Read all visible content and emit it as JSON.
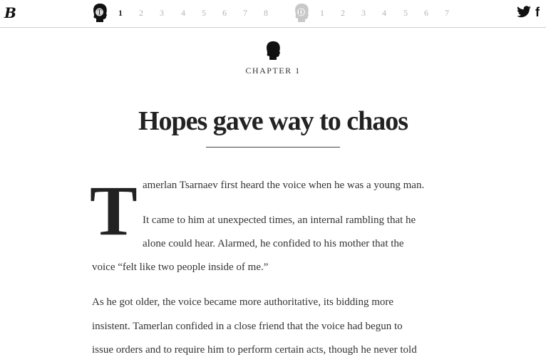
{
  "nav": {
    "logo": "B",
    "group_t": {
      "avatar_letter": "T",
      "numbers": [
        "1",
        "2",
        "3",
        "4",
        "5",
        "6",
        "7",
        "8"
      ],
      "active": "1"
    },
    "group_d": {
      "avatar_letter": "D",
      "numbers": [
        "1",
        "2",
        "3",
        "4",
        "5",
        "6",
        "7"
      ]
    },
    "social": {
      "twitter": "twitter-icon",
      "facebook": "f"
    }
  },
  "chapter": {
    "label": "CHAPTER 1",
    "title": "Hopes gave way to chaos"
  },
  "article": {
    "dropcap": "T",
    "lines_first": [
      "amerlan Tsarnaev first heard the voice when he was a young man.",
      "It came to him at unexpected times, an internal rambling that he",
      "alone could hear. Alarmed, he confided to his mother that the",
      "voice “felt like two people inside of me.”"
    ],
    "lines_second": [
      "As he got older, the voice became more authoritative, its bidding more",
      "insistent. Tamerlan confided in a close friend that the voice had begun to",
      "issue orders and to require him to perform certain acts, though he never told"
    ]
  },
  "colors": {
    "active_number": "#222222",
    "inactive_number": "#b3b3b3",
    "d_avatar": "#c8c8c8"
  }
}
